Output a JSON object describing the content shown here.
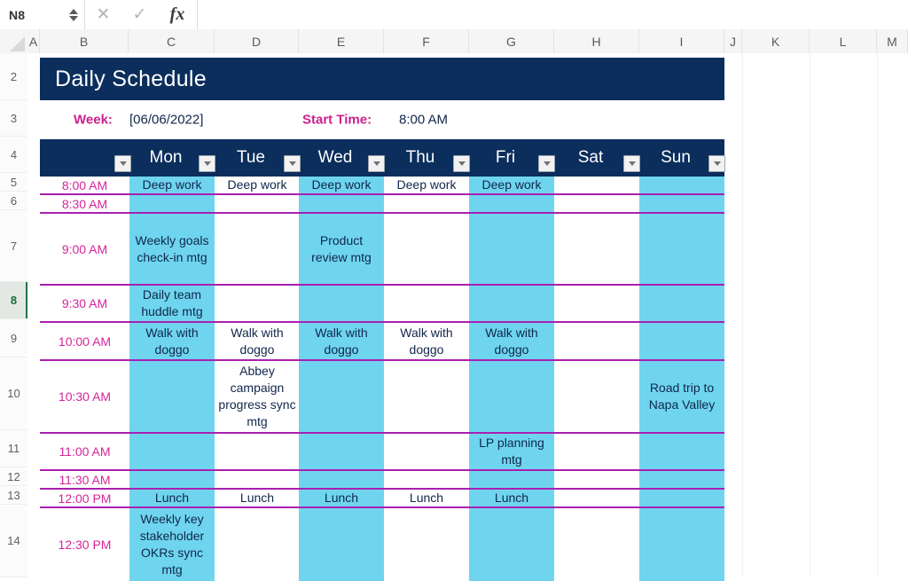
{
  "formula_bar": {
    "name_box_value": "N8",
    "cancel_icon": "close-icon",
    "confirm_icon": "check-icon",
    "function_icon": "fx-icon",
    "formula_value": "",
    "formula_placeholder": ""
  },
  "column_headers": [
    "A",
    "B",
    "C",
    "D",
    "E",
    "F",
    "G",
    "H",
    "I",
    "J",
    "K",
    "L",
    "M"
  ],
  "row_headers": [
    "2",
    "3",
    "4",
    "5",
    "6",
    "7",
    "8",
    "9",
    "10",
    "11",
    "12",
    "13",
    "14"
  ],
  "selected_row": "8",
  "sheet": {
    "title": "Daily Schedule",
    "week_label": "Week:",
    "week_value": "[06/06/2022]",
    "start_time_label": "Start Time:",
    "start_time_value": "8:00 AM",
    "days": [
      "Mon",
      "Tue",
      "Wed",
      "Thu",
      "Fri",
      "Sat",
      "Sun"
    ],
    "filter_icon": "filter-dropdown-icon",
    "times": [
      "8:00 AM",
      "8:30 AM",
      "9:00 AM",
      "9:30 AM",
      "10:00 AM",
      "10:30 AM",
      "11:00 AM",
      "11:30 AM",
      "12:00 PM",
      "12:30 PM"
    ],
    "events": [
      [
        "Deep work",
        "Deep work",
        "Deep work",
        "Deep work",
        "Deep work",
        "",
        ""
      ],
      [
        "",
        "",
        "",
        "",
        "",
        "",
        ""
      ],
      [
        "Weekly goals check-in mtg",
        "",
        "Product review mtg",
        "",
        "",
        "",
        ""
      ],
      [
        "Daily team huddle mtg",
        "",
        "",
        "",
        "",
        "",
        ""
      ],
      [
        "Walk with doggo",
        "Walk with doggo",
        "Walk with doggo",
        "Walk with doggo",
        "Walk with doggo",
        "",
        ""
      ],
      [
        "",
        "Abbey campaign progress sync mtg",
        "",
        "",
        "",
        "",
        "Road trip to Napa Valley"
      ],
      [
        "",
        "",
        "",
        "",
        "LP planning mtg",
        "",
        ""
      ],
      [
        "",
        "",
        "",
        "",
        "",
        "",
        ""
      ],
      [
        "Lunch",
        "Lunch",
        "Lunch",
        "Lunch",
        "Lunch",
        "",
        ""
      ],
      [
        "Weekly key stakeholder OKRs sync mtg",
        "",
        "",
        "",
        "",
        "",
        ""
      ]
    ]
  },
  "colors": {
    "header_navy": "#0b2e5c",
    "accent_cyan": "#6fd5ef",
    "accent_magenta": "#cc1f8e",
    "row_divider": "#a91fb0",
    "time_text": "#d6249a",
    "event_text": "#10264a"
  }
}
